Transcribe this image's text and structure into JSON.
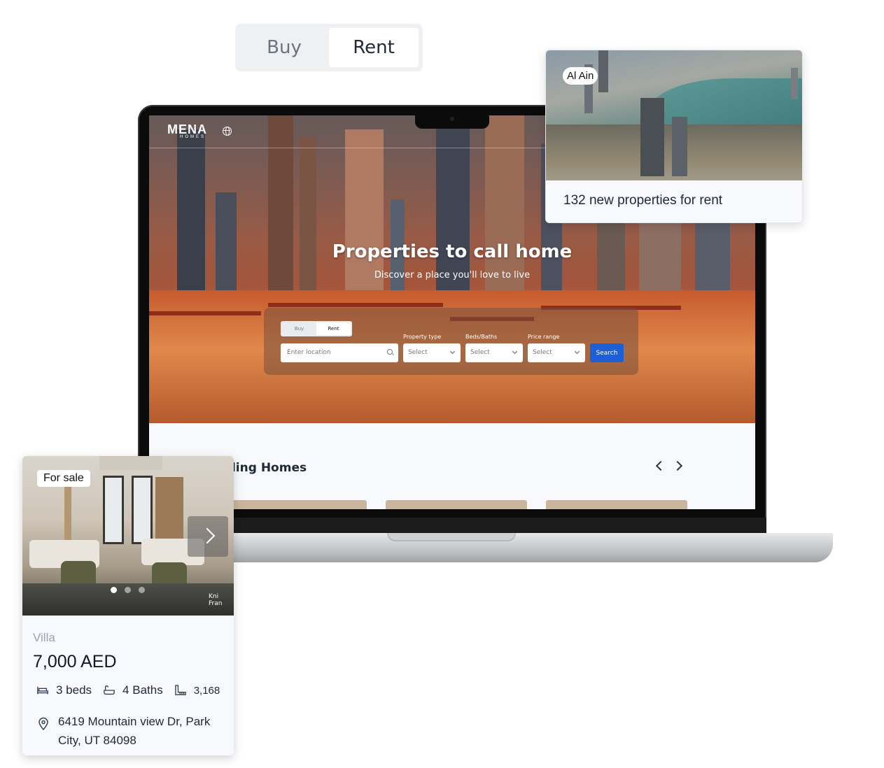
{
  "toggle": {
    "buy": "Buy",
    "rent": "Rent",
    "selected": "Rent"
  },
  "site": {
    "logo": "MENA",
    "logo_sub": "HOMES",
    "hero_title": "Properties to call home",
    "hero_subtitle": "Discover a place you'll love to live",
    "search": {
      "buy": "Buy",
      "rent": "Rent",
      "location_placeholder": "Enter location",
      "property_type_label": "Property type",
      "beds_baths_label": "Beds/Baths",
      "price_range_label": "Price range",
      "select": "Select",
      "search_button": "Search"
    },
    "trending_title": "ending Homes"
  },
  "city_card": {
    "badge": "Al Ain",
    "caption": "132 new properties for rent"
  },
  "property_card": {
    "badge": "For sale",
    "type": "Villa",
    "price": "7,000 AED",
    "beds": "3 beds",
    "baths": "4 Baths",
    "area": "3,168",
    "address": "6419 Mountain view Dr, Park City, UT 84098",
    "watermark": "Kni Fran",
    "carousel": {
      "count": 3,
      "active": 1
    }
  },
  "colors": {
    "search_button": "#1d5fd6",
    "card_bg": "#f7f9fc"
  },
  "icons": [
    "globe-icon",
    "search-icon",
    "chevron-down-icon",
    "chevron-left-icon",
    "chevron-right-icon",
    "bed-icon",
    "bath-icon",
    "area-icon",
    "location-pin-icon"
  ]
}
